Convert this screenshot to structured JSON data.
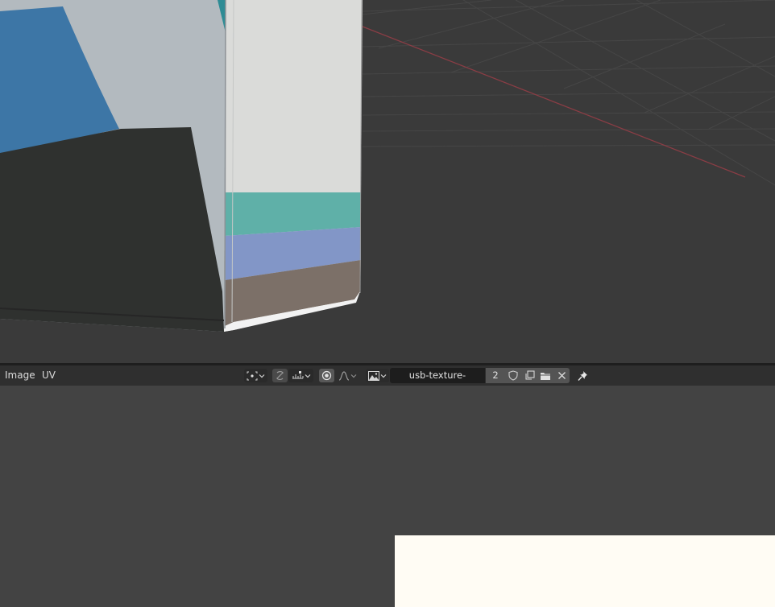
{
  "viewport": {
    "background": "#3a3a3a",
    "grid_color": "#474747",
    "x_axis_color": "#8a3d45",
    "object_colors": {
      "dark_base": "#2f312f",
      "panel_grey": "#b5bcc1",
      "blue_band": "#3d76a6",
      "teal_band": "#5fb0a8",
      "lavender_band": "#8296c7",
      "taupe_band": "#7c7068",
      "light_face": "#dadbd9"
    }
  },
  "header": {
    "menus": [
      "Image",
      "UV"
    ],
    "tools": [
      {
        "icon": "pivot-point-icon",
        "has_dropdown": true
      },
      {
        "icon": "sync-selection-icon",
        "has_dropdown": false
      },
      {
        "icon": "snap-increment-icon",
        "has_dropdown": true
      },
      {
        "icon": "proportional-editing-icon",
        "active": true
      },
      {
        "icon": "falloff-curve-icon",
        "has_dropdown": true
      },
      {
        "icon": "image-browse-icon",
        "has_dropdown": true
      },
      {
        "icon": "fake-user-shield-icon"
      },
      {
        "icon": "duplicate-image-icon"
      },
      {
        "icon": "open-folder-icon"
      },
      {
        "icon": "unlink-close-icon"
      },
      {
        "icon": "pin-icon"
      }
    ],
    "image_name": "usb-texture-border.jpg",
    "user_count": "2"
  },
  "editor": {
    "background": "#434343",
    "image_background": "#fffcf4"
  }
}
